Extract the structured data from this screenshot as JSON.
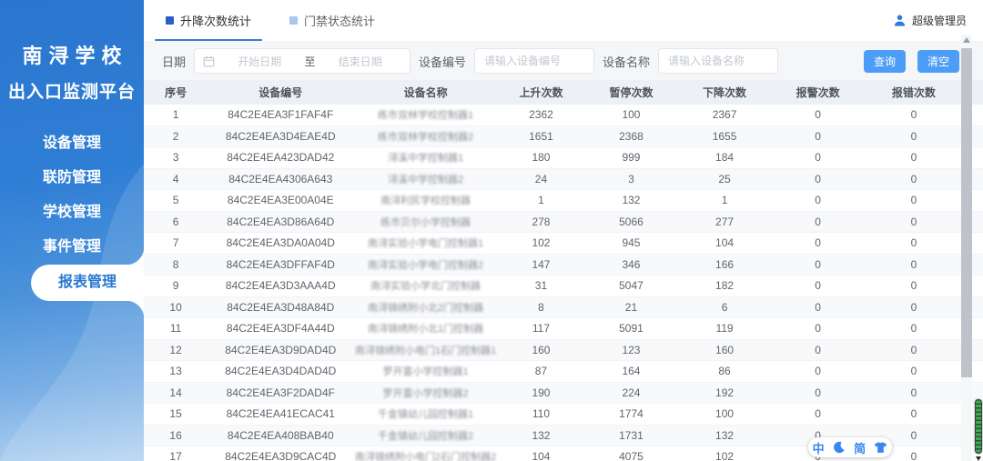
{
  "app": {
    "title_line1": "南浔学校",
    "title_line2": "出入口监测平台"
  },
  "sidebar": {
    "items": [
      {
        "label": "设备管理",
        "active": false
      },
      {
        "label": "联防管理",
        "active": false
      },
      {
        "label": "学校管理",
        "active": false
      },
      {
        "label": "事件管理",
        "active": false
      },
      {
        "label": "报表管理",
        "active": true
      }
    ]
  },
  "topbar": {
    "tabs": [
      {
        "label": "升降次数统计",
        "active": true
      },
      {
        "label": "门禁状态统计",
        "active": false
      }
    ],
    "user_name": "超级管理员",
    "user_icon": "user-icon"
  },
  "filters": {
    "date_label": "日期",
    "date_start_placeholder": "开始日期",
    "date_separator": "至",
    "date_end_placeholder": "结束日期",
    "calendar_icon": "calendar-icon",
    "device_id_label": "设备编号",
    "device_id_placeholder": "请输入设备编号",
    "device_id_value": "",
    "device_name_label": "设备名称",
    "device_name_placeholder": "请输入设备名称",
    "device_name_value": "",
    "search_button": "查询",
    "clear_button": "清空"
  },
  "table": {
    "columns": [
      "序号",
      "设备编号",
      "设备名称",
      "上升次数",
      "暂停次数",
      "下降次数",
      "报警次数",
      "报错次数"
    ],
    "device_name_note": "names are privacy-blurred in source screenshot",
    "rows": [
      {
        "seq": 1,
        "device_id": "84C2E4EA3F1FAF4F",
        "device_name": "练市双林学校控制器1",
        "up": 2362,
        "pause": 100,
        "down": 2367,
        "alarm": 0,
        "error": 0
      },
      {
        "seq": 2,
        "device_id": "84C2E4EA3D4EAE4D",
        "device_name": "练市双林学校控制器2",
        "up": 1651,
        "pause": 2368,
        "down": 1655,
        "alarm": 0,
        "error": 0
      },
      {
        "seq": 3,
        "device_id": "84C2E4EA423DAD42",
        "device_name": "浔溪中学控制器1",
        "up": 180,
        "pause": 999,
        "down": 184,
        "alarm": 0,
        "error": 0
      },
      {
        "seq": 4,
        "device_id": "84C2E4EA4306A643",
        "device_name": "浔溪中学控制器2",
        "up": 24,
        "pause": 3,
        "down": 25,
        "alarm": 0,
        "error": 0
      },
      {
        "seq": 5,
        "device_id": "84C2E4EA3E00A04E",
        "device_name": "南浔利民学校控制器",
        "up": 1,
        "pause": 132,
        "down": 1,
        "alarm": 0,
        "error": 0
      },
      {
        "seq": 6,
        "device_id": "84C2E4EA3D86A64D",
        "device_name": "练市贝尔小学控制器",
        "up": 278,
        "pause": 5066,
        "down": 277,
        "alarm": 0,
        "error": 0
      },
      {
        "seq": 7,
        "device_id": "84C2E4EA3DA0A04D",
        "device_name": "南浔实验小学电门控制器1",
        "up": 102,
        "pause": 945,
        "down": 104,
        "alarm": 0,
        "error": 0
      },
      {
        "seq": 8,
        "device_id": "84C2E4EA3DFFAF4D",
        "device_name": "南浔实验小学电门控制器2",
        "up": 147,
        "pause": 346,
        "down": 166,
        "alarm": 0,
        "error": 0
      },
      {
        "seq": 9,
        "device_id": "84C2E4EA3D3AAA4D",
        "device_name": "南浔实验小学北门控制器",
        "up": 31,
        "pause": 5047,
        "down": 182,
        "alarm": 0,
        "error": 0
      },
      {
        "seq": 10,
        "device_id": "84C2E4EA3D48A84D",
        "device_name": "南浔锦绣附小北2门控制器",
        "up": 8,
        "pause": 21,
        "down": 6,
        "alarm": 0,
        "error": 0
      },
      {
        "seq": 11,
        "device_id": "84C2E4EA3DF4A44D",
        "device_name": "南浔锦绣附小北1门控制器",
        "up": 117,
        "pause": 5091,
        "down": 119,
        "alarm": 0,
        "error": 0
      },
      {
        "seq": 12,
        "device_id": "84C2E4EA3D9DAD4D",
        "device_name": "南浔锦绣附小电门1石门控制器1",
        "up": 160,
        "pause": 123,
        "down": 160,
        "alarm": 0,
        "error": 0
      },
      {
        "seq": 13,
        "device_id": "84C2E4EA3D4DAD4D",
        "device_name": "罗开富小学控制器1",
        "up": 87,
        "pause": 164,
        "down": 86,
        "alarm": 0,
        "error": 0
      },
      {
        "seq": 14,
        "device_id": "84C2E4EA3F2DAD4F",
        "device_name": "罗开富小学控制器2",
        "up": 190,
        "pause": 224,
        "down": 192,
        "alarm": 0,
        "error": 0
      },
      {
        "seq": 15,
        "device_id": "84C2E4EA41ECAC41",
        "device_name": "千金镇幼儿园控制器1",
        "up": 110,
        "pause": 1774,
        "down": 100,
        "alarm": 0,
        "error": 0
      },
      {
        "seq": 16,
        "device_id": "84C2E4EA408BAB40",
        "device_name": "千金镇幼儿园控制器2",
        "up": 132,
        "pause": 1731,
        "down": 132,
        "alarm": 0,
        "error": 0
      },
      {
        "seq": 17,
        "device_id": "84C2E4EA3D9CAC4D",
        "device_name": "南浔锦绣附小电门2石门控制器2",
        "up": 104,
        "pause": 4075,
        "down": 102,
        "alarm": 0,
        "error": 0
      }
    ]
  },
  "ime_toolbar": {
    "mode": "中",
    "charset": "简",
    "icons": [
      "moon-icon",
      "skin-icon"
    ]
  },
  "colors": {
    "accent_button": "#4b9df8",
    "sidebar_blue_top": "#2b76cf",
    "sidebar_blue_bottom": "#b7d5f2",
    "active_item_text": "#2a79d0",
    "tab_active_bullet": "#2b5fc8",
    "tab_underline": "#3a7bd5",
    "table_header_bg": "#edf0f5",
    "ime_blue": "#3a86f0",
    "edge_scroll_green": "#35b14a"
  }
}
